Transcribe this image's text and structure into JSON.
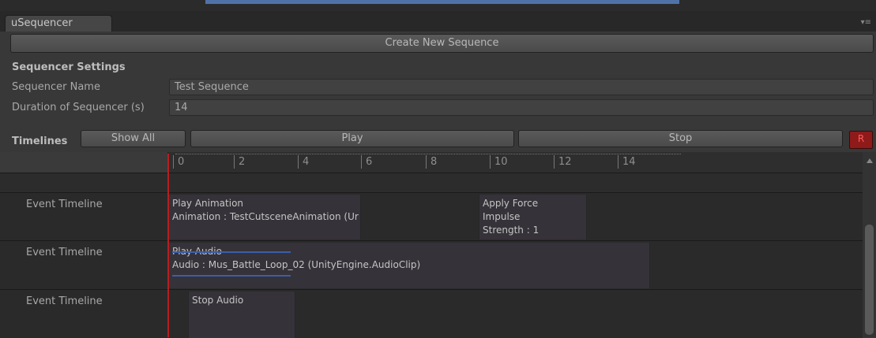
{
  "window": {
    "tab_title": "uSequencer",
    "menu_glyph": "▾≡"
  },
  "toolbar": {
    "create_label": "Create New Sequence"
  },
  "settings": {
    "title": "Sequencer Settings",
    "name_label": "Sequencer Name",
    "name_value": "Test Sequence",
    "duration_label": "Duration of Sequencer (s)",
    "duration_value": "14"
  },
  "timelines": {
    "title": "Timelines",
    "show_all_label": "Show All",
    "play_label": "Play",
    "stop_label": "Stop",
    "record_label": "R"
  },
  "ruler": {
    "ticks": [
      "0",
      "2",
      "4",
      "6",
      "8",
      "10",
      "12",
      "14"
    ]
  },
  "rows": [
    {
      "label": "Event Timeline",
      "events": [
        {
          "lines": [
            "Play Animation",
            "Animation : TestCutsceneAnimation (Ur"
          ]
        },
        {
          "lines": [
            "Apply Force",
            "Impulse",
            "Strength : 1"
          ]
        }
      ]
    },
    {
      "label": "Event Timeline",
      "events": [
        {
          "lines": [
            "Play Audio",
            "Audio : Mus_Battle_Loop_02 (UnityEngine.AudioClip)"
          ]
        }
      ]
    },
    {
      "label": "Event Timeline",
      "events": [
        {
          "lines": [
            "Stop Audio"
          ]
        }
      ]
    }
  ],
  "colors": {
    "playhead": "#b81e1e",
    "record_button": "#8e1a1a",
    "waveform": "#3a5fa8"
  }
}
